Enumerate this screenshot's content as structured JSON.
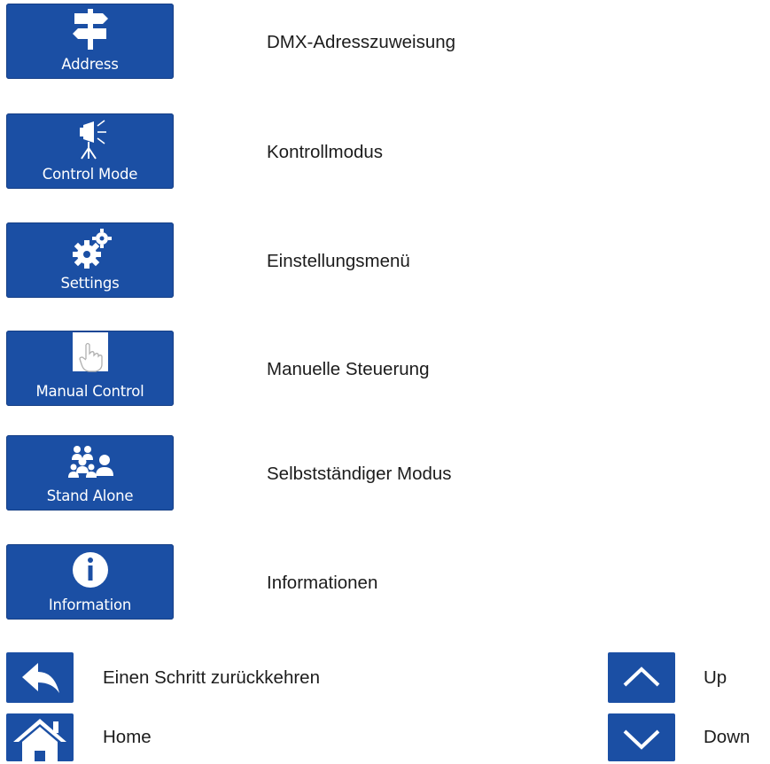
{
  "menu": [
    {
      "icon": "signpost-icon",
      "button_label": "Address",
      "description": "DMX-Adresszuweisung"
    },
    {
      "icon": "spotlight-icon",
      "button_label": "Control Mode",
      "description": "Kontrollmodus"
    },
    {
      "icon": "gears-icon",
      "button_label": "Settings",
      "description": "Einstellungsmenü"
    },
    {
      "icon": "hand-pointer-icon",
      "button_label": "Manual Control",
      "description": "Manuelle Steuerung"
    },
    {
      "icon": "people-group-icon",
      "button_label": "Stand Alone",
      "description": "Selbstständiger Modus"
    },
    {
      "icon": "info-icon",
      "button_label": "Information",
      "description": "Informationen"
    }
  ],
  "nav": {
    "back": {
      "icon": "back-arrow-icon",
      "description": "Einen Schritt zurückkehren"
    },
    "home": {
      "icon": "home-icon",
      "description": "Home"
    },
    "up": {
      "icon": "chevron-up-icon",
      "description": "Up"
    },
    "down": {
      "icon": "chevron-down-icon",
      "description": "Down"
    }
  },
  "colors": {
    "button_blue": "#1b4fa4",
    "icon_white": "#ffffff",
    "text": "#1c1c1c"
  }
}
